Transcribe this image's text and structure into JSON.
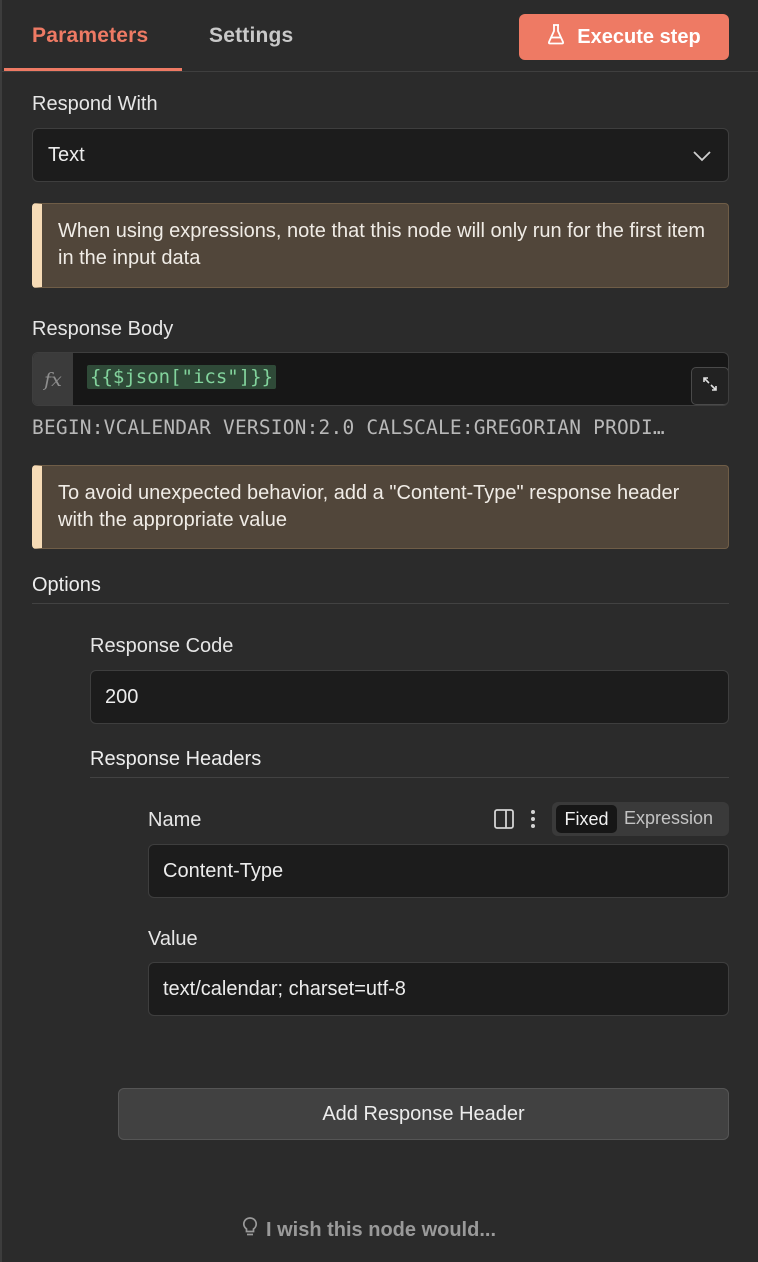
{
  "tabs": [
    {
      "label": "Parameters",
      "active": true
    },
    {
      "label": "Settings",
      "active": false
    }
  ],
  "execute_button": {
    "label": "Execute step",
    "icon": "flask-icon",
    "color": "#ee7a64"
  },
  "respond_with": {
    "label": "Respond With",
    "value": "Text"
  },
  "notice_expressions": "When using expressions, note that this node will only run for the first item in the input data",
  "response_body": {
    "label": "Response Body",
    "fx_label": "fx",
    "expression": "{{$json[\"ics\"]}}",
    "preview": "BEGIN:VCALENDAR VERSION:2.0 CALSCALE:GREGORIAN PRODI…"
  },
  "notice_content_type": "To avoid unexpected behavior, add a \"Content-Type\" response header with the appropriate value",
  "options": {
    "title": "Options",
    "response_code": {
      "label": "Response Code",
      "value": "200"
    },
    "response_headers": {
      "title": "Response Headers",
      "name": {
        "label": "Name",
        "value": "Content-Type"
      },
      "value": {
        "label": "Value",
        "value": "text/calendar; charset=utf-8"
      },
      "mode_toggle": {
        "fixed": "Fixed",
        "expression": "Expression",
        "selected": "Fixed"
      }
    },
    "add_header_button": "Add Response Header"
  },
  "footer": {
    "wish_text": "I wish this node would..."
  }
}
